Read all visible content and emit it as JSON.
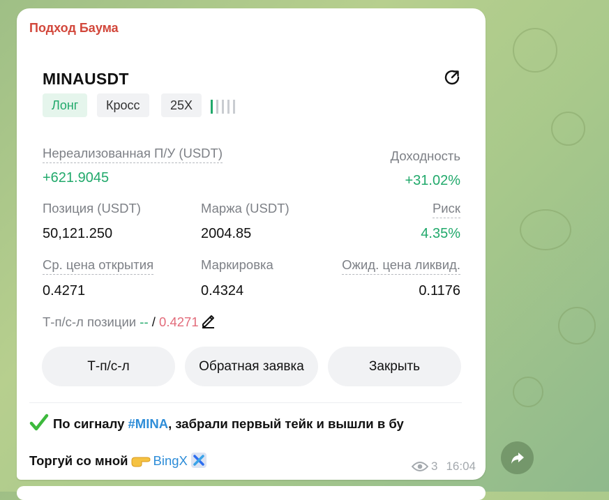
{
  "message": {
    "sender": "Подход Баума",
    "views": "3",
    "time": "16:04"
  },
  "position": {
    "symbol": "MINAUSDT",
    "side": "Лонг",
    "margin_mode": "Кросс",
    "leverage": "25X",
    "leverage_level": 0.2,
    "unrealized_label": "Нереализованная П/У (USDT)",
    "unrealized_value": "+621.9045",
    "yield_label": "Доходность",
    "yield_value": "+31.02%",
    "size_label": "Позиция (USDT)",
    "size_value": "50,121.250",
    "margin_label": "Маржа (USDT)",
    "margin_value": "2004.85",
    "risk_label": "Риск",
    "risk_value": "4.35%",
    "entry_label": "Ср. цена открытия",
    "entry_value": "0.4271",
    "mark_label": "Маркировка",
    "mark_value": "0.4324",
    "liq_label": "Ожид. цена ликвид.",
    "liq_value": "0.1176",
    "tpsl_label": "Т-п/с-л позиции",
    "tpsl_tp": "--",
    "tpsl_sep": "/",
    "tpsl_sl": "0.4271"
  },
  "buttons": {
    "tpsl": "Т-п/с-л",
    "reverse": "Обратная заявка",
    "close": "Закрыть"
  },
  "caption": {
    "line1_before": "По сигналу",
    "hashtag": "#MINA",
    "line1_after": ", забрали первый тейк и вышли в бу",
    "line2_text": "Торгуй со мной",
    "link": "BingX"
  },
  "colors": {
    "green": "#21a96b",
    "red": "#e26b7a",
    "sender": "#d2473b",
    "link": "#2e8dd8"
  },
  "icons": [
    "share-icon",
    "pencil-icon",
    "check-mark-icon",
    "pointing-hand-icon",
    "cross-x-icon",
    "eye-icon",
    "forward-arrow-icon"
  ]
}
